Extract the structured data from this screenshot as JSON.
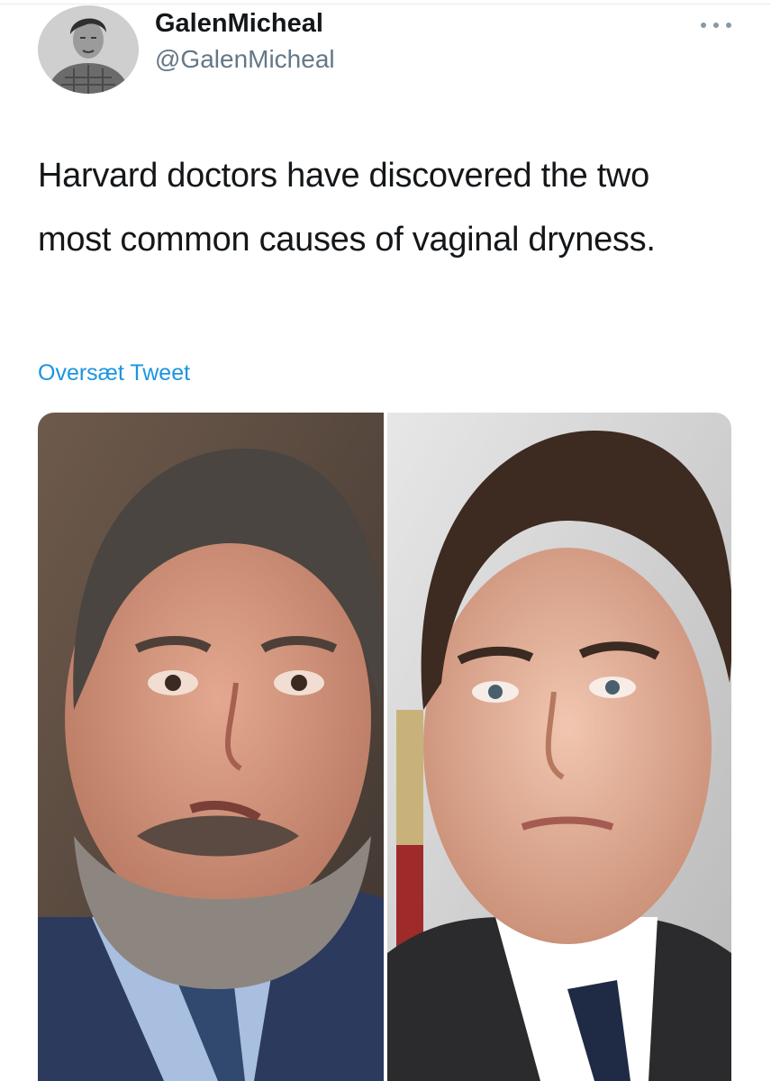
{
  "tweet": {
    "author": {
      "display_name": "GalenMicheal",
      "handle": "@GalenMicheal",
      "avatar": "profile-photo"
    },
    "more_icon": "more-dots-icon",
    "text": "Harvard doctors have discovered the two most common causes of vaginal dryness.",
    "translate_label": "Oversæt Tweet",
    "media": [
      {
        "name": "photo-left",
        "kind": "portrait-photo"
      },
      {
        "name": "photo-right",
        "kind": "portrait-photo"
      }
    ]
  },
  "colors": {
    "text": "#14171a",
    "secondary": "#657786",
    "link": "#1b95e0"
  }
}
